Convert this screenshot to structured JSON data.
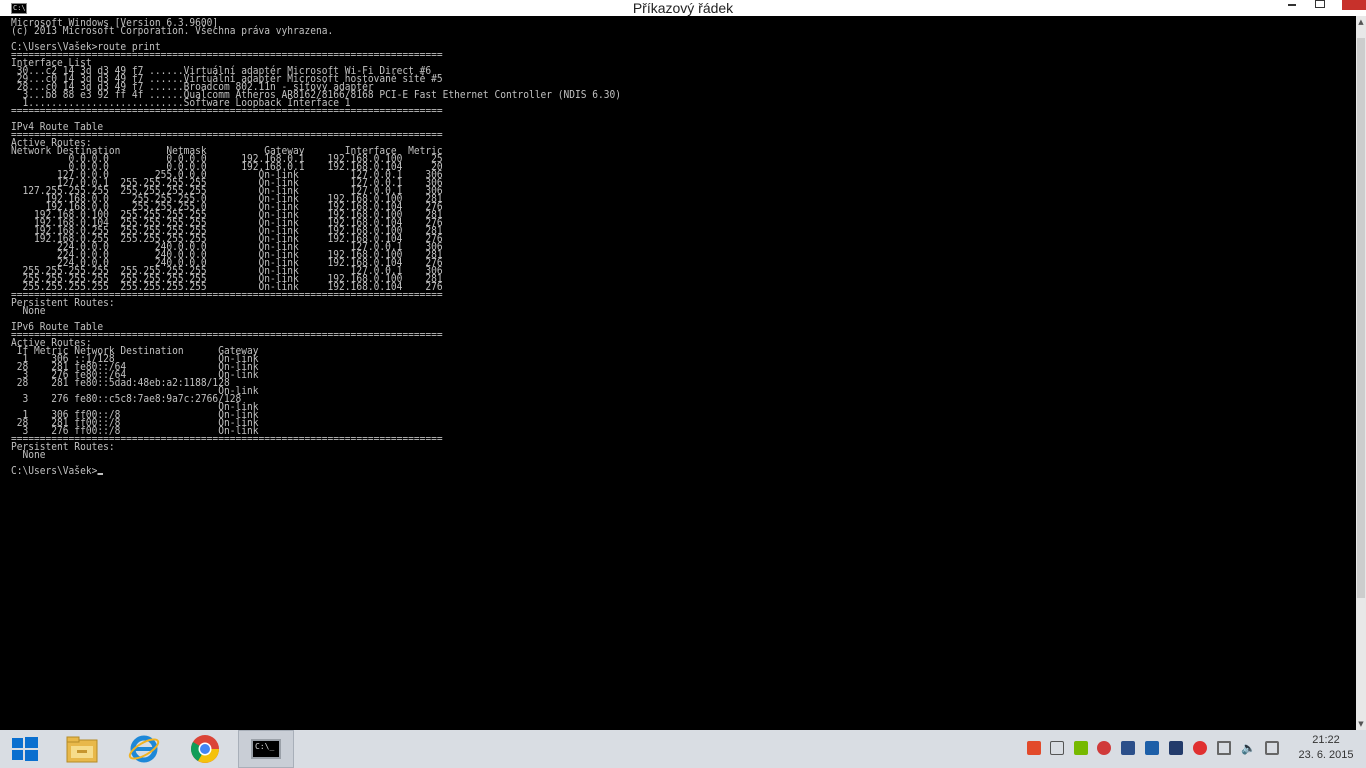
{
  "window": {
    "title": "Příkazový řádek",
    "icon_text": "C:\\",
    "minimize_glyph": "",
    "close_color": "#c7312b"
  },
  "console": {
    "lines": [
      "Microsoft Windows [Version 6.3.9600]",
      "(c) 2013 Microsoft Corporation. Všechna práva vyhrazena.",
      "",
      "C:\\Users\\Vašek>route print",
      "===========================================================================",
      "Interface List",
      " 30...c2 14 3d d3 49 f7 ......Virtuální adaptér Microsoft Wi-Fi Direct #6",
      " 29...c0 14 3d d3 49 f7 ......Virtuální adaptér Microsoft hostované sítě #5",
      " 28...c0 14 3d d3 49 f7 ......Broadcom 802.11n - síťový adaptér",
      "  3...b8 88 e3 92 ff 4f ......Qualcomm Atheros AR8162/8166/8168 PCI-E Fast Ethernet Controller (NDIS 6.30)",
      "  1...........................Software Loopback Interface 1",
      "===========================================================================",
      "",
      "IPv4 Route Table",
      "===========================================================================",
      "Active Routes:",
      "Network Destination        Netmask          Gateway       Interface  Metric",
      "          0.0.0.0          0.0.0.0      192.168.0.1    192.168.0.100     25",
      "          0.0.0.0          0.0.0.0      192.168.0.1    192.168.0.104     20",
      "        127.0.0.0        255.0.0.0         On-link         127.0.0.1    306",
      "        127.0.0.1  255.255.255.255         On-link         127.0.0.1    306",
      "  127.255.255.255  255.255.255.255         On-link         127.0.0.1    306",
      "      192.168.0.0    255.255.255.0         On-link     192.168.0.100    281",
      "      192.168.0.0    255.255.255.0         On-link     192.168.0.104    276",
      "    192.168.0.100  255.255.255.255         On-link     192.168.0.100    281",
      "    192.168.0.104  255.255.255.255         On-link     192.168.0.104    276",
      "    192.168.0.255  255.255.255.255         On-link     192.168.0.100    281",
      "    192.168.0.255  255.255.255.255         On-link     192.168.0.104    276",
      "        224.0.0.0        240.0.0.0         On-link         127.0.0.1    306",
      "        224.0.0.0        240.0.0.0         On-link     192.168.0.100    281",
      "        224.0.0.0        240.0.0.0         On-link     192.168.0.104    276",
      "  255.255.255.255  255.255.255.255         On-link         127.0.0.1    306",
      "  255.255.255.255  255.255.255.255         On-link     192.168.0.100    281",
      "  255.255.255.255  255.255.255.255         On-link     192.168.0.104    276",
      "===========================================================================",
      "Persistent Routes:",
      "  None",
      "",
      "IPv6 Route Table",
      "===========================================================================",
      "Active Routes:",
      " If Metric Network Destination      Gateway",
      "  1    306 ::1/128                  On-link",
      " 28    281 fe80::/64                On-link",
      "  3    276 fe80::/64                On-link",
      " 28    281 fe80::5dad:48eb:a2:1188/128",
      "                                    On-link",
      "  3    276 fe80::c5c8:7ae8:9a7c:2766/128",
      "                                    On-link",
      "  1    306 ff00::/8                 On-link",
      " 28    281 ff00::/8                 On-link",
      "  3    276 ff00::/8                 On-link",
      "===========================================================================",
      "Persistent Routes:",
      "  None",
      "",
      "C:\\Users\\Vašek>"
    ],
    "text_color": "#c0c0c0",
    "background": "#000000"
  },
  "taskbar": {
    "items": [
      {
        "name": "file-explorer",
        "icon": "folder-icon"
      },
      {
        "name": "internet-explorer",
        "icon": "ie-icon"
      },
      {
        "name": "google-chrome",
        "icon": "chrome-icon"
      },
      {
        "name": "command-prompt",
        "icon": "cmd-icon",
        "active": true,
        "icon_text": "C:\\_"
      }
    ],
    "tray_icons": [
      "recycle-icon",
      "flag-icon",
      "nvidia-icon",
      "vpn-icon",
      "display-icon",
      "network-adapter-icon",
      "task-manager-icon",
      "shield-icon",
      "network-icon",
      "volume-icon",
      "power-icon"
    ],
    "clock": {
      "time": "21:22",
      "date": "23. 6. 2015"
    }
  }
}
